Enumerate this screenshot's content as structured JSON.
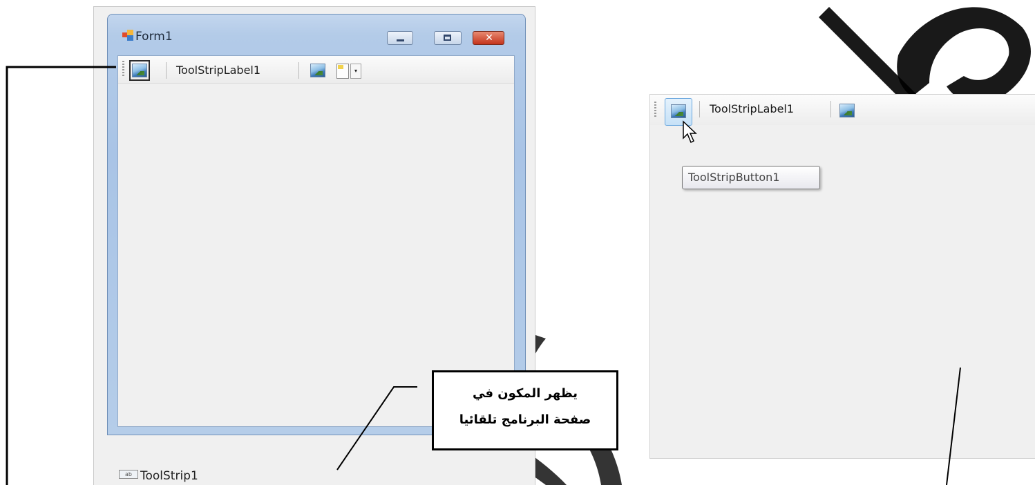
{
  "form": {
    "title": "Form1",
    "icon": "form-icon",
    "caption_buttons": [
      "minimize",
      "maximize",
      "close"
    ],
    "close_glyph": "✕"
  },
  "toolstrip": {
    "items": [
      {
        "type": "button",
        "icon": "image-icon",
        "selected": true
      },
      {
        "type": "label",
        "text": "ToolStripLabel1"
      },
      {
        "type": "separator"
      },
      {
        "type": "button",
        "icon": "image-icon"
      },
      {
        "type": "dropdown",
        "icon": "new-item-icon",
        "arrow": "▾"
      }
    ]
  },
  "component_tray": {
    "icon_text": "ab",
    "label": "ToolStrip1"
  },
  "preview": {
    "label": "ToolStripLabel1",
    "tooltip": "ToolStripButton1"
  },
  "callout": {
    "line1": "يظهر المكون في",
    "line2": "صفحة البرنامج تلقائيا"
  },
  "colors": {
    "title_bar": "#b3cbe8",
    "close_button": "#c4341c",
    "client_background": "#f0f0f0",
    "hover_highlight": "#c6e1f7"
  }
}
